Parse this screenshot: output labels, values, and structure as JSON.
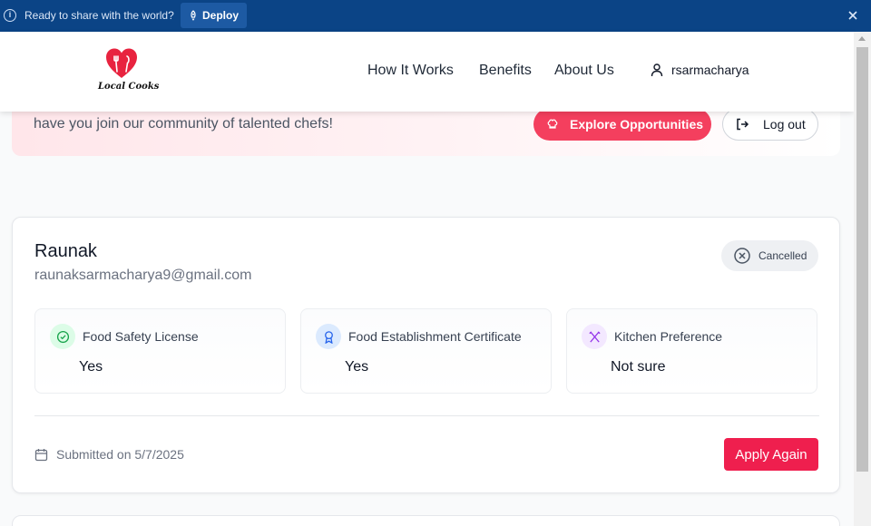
{
  "deploy_bar": {
    "message": "Ready to share with the world?",
    "deploy_label": "Deploy",
    "colors": {
      "background": "#0b4486",
      "button": "#1d5aa3"
    }
  },
  "header": {
    "brand": "Local Cooks",
    "nav": [
      "How It Works",
      "Benefits",
      "About Us"
    ],
    "username": "rsarmacharya"
  },
  "hero": {
    "description": "Track, manage and update your Local Cooks applications. We're excited to have you join our community of talented chefs!",
    "explore_label": "Explore Opportunities",
    "logout_label": "Log out"
  },
  "application": {
    "name": "Raunak",
    "email": "raunaksarmacharya9@gmail.com",
    "status": "Cancelled",
    "details": [
      {
        "label": "Food Safety License",
        "value": "Yes",
        "icon": "check-circle-icon",
        "color": "#16a34a"
      },
      {
        "label": "Food Establishment Certificate",
        "value": "Yes",
        "icon": "award-icon",
        "color": "#2563eb"
      },
      {
        "label": "Kitchen Preference",
        "value": "Not sure",
        "icon": "utensils-crossed-icon",
        "color": "#9333ea"
      }
    ],
    "submitted": "Submitted on 5/7/2025",
    "apply_label": "Apply Again"
  },
  "accent_color": "#ef1f4e"
}
